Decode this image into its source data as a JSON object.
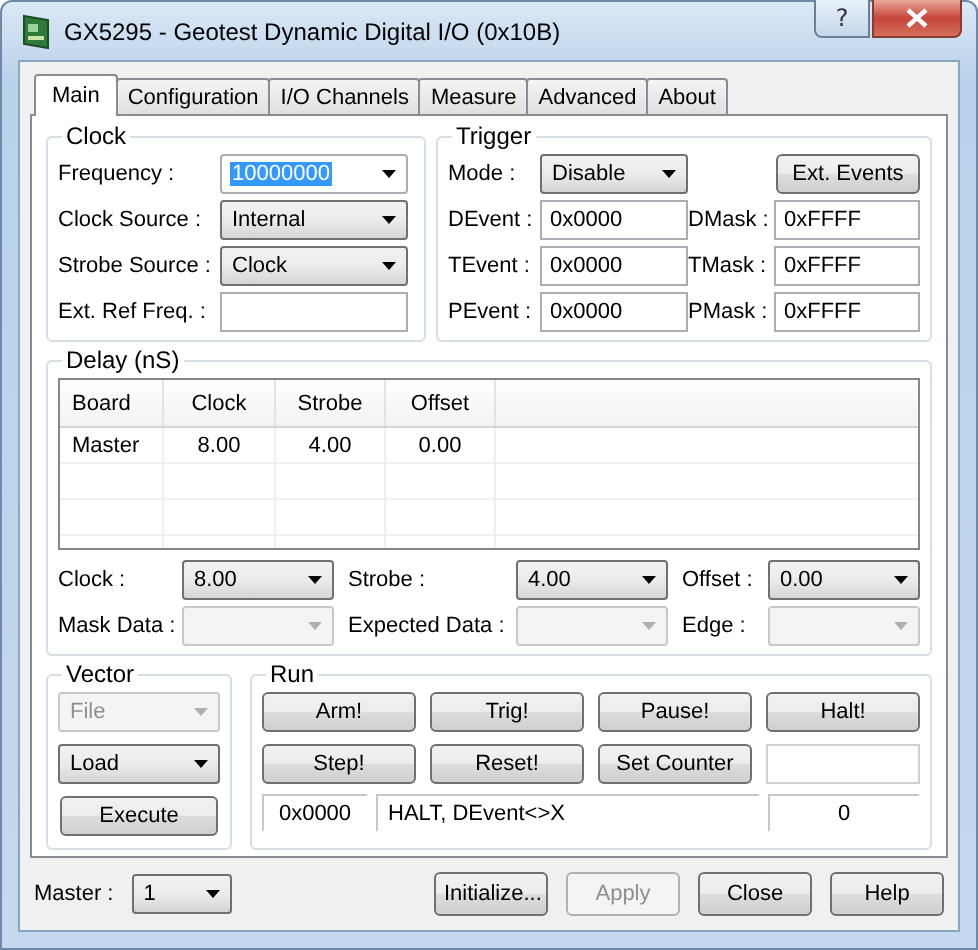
{
  "window": {
    "title": "GX5295 - Geotest Dynamic Digital I/O  (0x10B)",
    "help_button": "?"
  },
  "tabs": [
    {
      "label": "Main",
      "selected": true
    },
    {
      "label": "Configuration",
      "selected": false
    },
    {
      "label": "I/O Channels",
      "selected": false
    },
    {
      "label": "Measure",
      "selected": false
    },
    {
      "label": "Advanced",
      "selected": false
    },
    {
      "label": "About",
      "selected": false
    }
  ],
  "clock": {
    "title": "Clock",
    "fields": [
      {
        "label": "Frequency :",
        "kind": "editable",
        "value": "10000000",
        "text_selected": true
      },
      {
        "label": "Clock Source :",
        "kind": "list",
        "value": "Internal"
      },
      {
        "label": "Strobe Source :",
        "kind": "list",
        "value": "Clock"
      },
      {
        "label": "Ext. Ref Freq. :",
        "kind": "input"
      }
    ]
  },
  "trigger": {
    "title": "Trigger",
    "mode_label": "Mode :",
    "mode_value": "Disable",
    "ext_button": "Ext. Events",
    "events": [
      {
        "label": "DEvent :",
        "value": "0x0000",
        "mask_label": "DMask :",
        "mask_value": "0xFFFF"
      },
      {
        "label": "TEvent :",
        "value": "0x0000",
        "mask_label": "TMask :",
        "mask_value": "0xFFFF"
      },
      {
        "label": "PEvent :",
        "value": "0x0000",
        "mask_label": "PMask :",
        "mask_value": "0xFFFF"
      }
    ]
  },
  "delay": {
    "title": "Delay (nS)",
    "columns": [
      "Board",
      "Clock",
      "Strobe",
      "Offset"
    ],
    "rows": [
      [
        "Master",
        "8.00",
        "4.00",
        "0.00"
      ]
    ],
    "controls": [
      {
        "label": "Clock :",
        "value": "8.00",
        "disabled": false
      },
      {
        "label": "Strobe :",
        "value": "4.00",
        "disabled": false
      },
      {
        "label": "Offset :",
        "value": "0.00",
        "disabled": false
      },
      {
        "label": "Mask Data :",
        "disabled": true
      },
      {
        "label": "Expected Data :",
        "disabled": true
      },
      {
        "label": "Edge :",
        "disabled": true
      }
    ]
  },
  "vector": {
    "title": "Vector",
    "combos": [
      {
        "value": "File",
        "disabled": true
      },
      {
        "value": "Load",
        "disabled": false
      }
    ],
    "execute": "Execute"
  },
  "run": {
    "title": "Run",
    "buttons": [
      "Arm!",
      "Trig!",
      "Pause!",
      "Halt!",
      "Step!",
      "Reset!",
      "Set Counter"
    ],
    "address": "0x0000",
    "message": "HALT, DEvent<>X",
    "count": "0"
  },
  "footer": {
    "master_label": "Master :",
    "master_value": "1",
    "buttons": [
      {
        "label": "Initialize...",
        "disabled": false
      },
      {
        "label": "Apply",
        "disabled": true
      },
      {
        "label": "Close",
        "disabled": false
      },
      {
        "label": "Help",
        "disabled": false
      }
    ]
  }
}
